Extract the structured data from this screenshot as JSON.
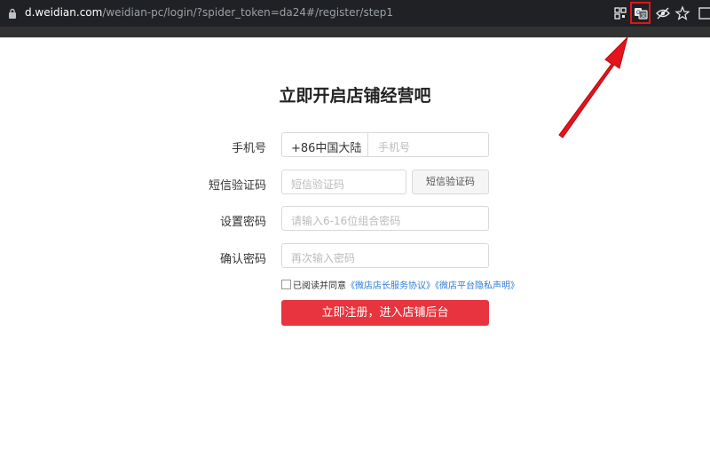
{
  "browser": {
    "url_host": "d.weidian.com",
    "url_path": "/weidian-pc/login/?spider_token=da24#/register/step1",
    "icons": [
      "qr-code-icon",
      "translate-icon",
      "eye-off-icon",
      "star-icon",
      "side-panel-icon"
    ],
    "highlight_color": "#e3141b"
  },
  "page": {
    "title": "立即开启店铺经营吧"
  },
  "form": {
    "phone_label": "手机号",
    "country_code": "+86中国大陆",
    "phone_placeholder": "手机号",
    "sms_label": "短信验证码",
    "sms_placeholder": "短信验证码",
    "sms_button": "短信验证码",
    "password_label": "设置密码",
    "password_placeholder": "请输入6-16位组合密码",
    "confirm_label": "确认密码",
    "confirm_placeholder": "再次输入密码",
    "agree_prefix": "已阅读并同意",
    "agreement_link_1": "《微店店长服务协议》",
    "agreement_link_2": "《微店平台隐私声明》",
    "submit_button": "立即注册，进入店铺后台",
    "accent_color": "#e8343e",
    "link_color": "#2e7cd6"
  }
}
